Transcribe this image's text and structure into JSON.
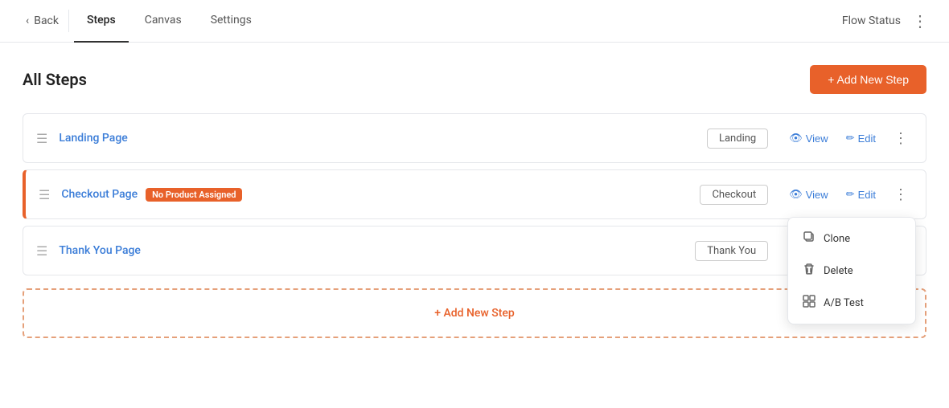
{
  "nav": {
    "back_label": "Back",
    "tabs": [
      {
        "id": "steps",
        "label": "Steps",
        "active": true
      },
      {
        "id": "canvas",
        "label": "Canvas",
        "active": false
      },
      {
        "id": "settings",
        "label": "Settings",
        "active": false
      }
    ],
    "flow_status_label": "Flow Status",
    "more_icon": "⋮"
  },
  "page": {
    "title": "All Steps",
    "add_new_step_label": "+ Add New Step"
  },
  "steps": [
    {
      "id": "landing",
      "name": "Landing Page",
      "type_badge": "Landing",
      "warning": null,
      "show_dropdown": false
    },
    {
      "id": "checkout",
      "name": "Checkout Page",
      "type_badge": "Checkout",
      "warning": "No Product Assigned",
      "show_dropdown": true
    },
    {
      "id": "thankyou",
      "name": "Thank You Page",
      "type_badge": "Thank You",
      "warning": null,
      "show_dropdown": false
    }
  ],
  "step_actions": {
    "view_label": "View",
    "edit_label": "Edit"
  },
  "dropdown_menu": {
    "items": [
      {
        "id": "clone",
        "label": "Clone",
        "icon": "⧉"
      },
      {
        "id": "delete",
        "label": "Delete",
        "icon": "🗑"
      },
      {
        "id": "ab_test",
        "label": "A/B Test",
        "icon": "⊞"
      }
    ]
  },
  "add_step_bottom": {
    "label": "+ Add New Step"
  }
}
